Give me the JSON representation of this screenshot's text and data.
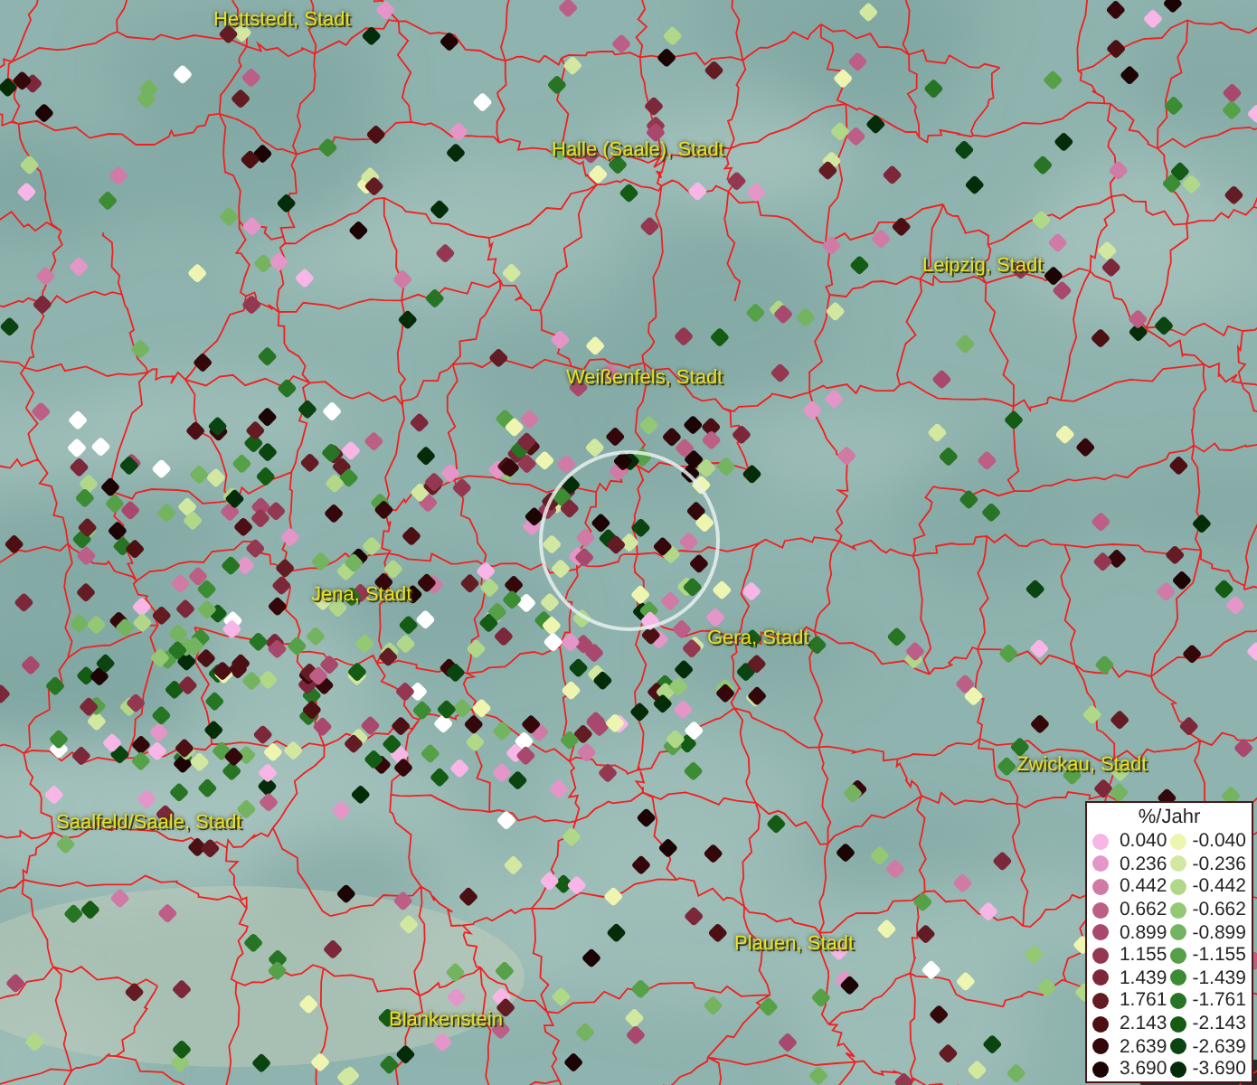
{
  "places": [
    {
      "label": "Hettstedt, Stadt"
    },
    {
      "label": "Halle (Saale), Stadt"
    },
    {
      "label": "Leipzig, Stadt"
    },
    {
      "label": "Weißenfels, Stadt"
    },
    {
      "label": "Jena, Stadt"
    },
    {
      "label": "Gera, Stadt"
    },
    {
      "label": "Zwickau, Stadt"
    },
    {
      "label": "Saalfeld/Saale, Stadt"
    },
    {
      "label": "Plauen, Stadt"
    },
    {
      "label": "Blankenstein"
    }
  ],
  "legend": {
    "title": "%/Jahr",
    "positive": [
      {
        "value": "0.040",
        "color": "#f7b6e6"
      },
      {
        "value": "0.236",
        "color": "#e496c8"
      },
      {
        "value": "0.442",
        "color": "#d07aa6"
      },
      {
        "value": "0.662",
        "color": "#bc5e86"
      },
      {
        "value": "0.899",
        "color": "#a8486c"
      },
      {
        "value": "1.155",
        "color": "#943852"
      },
      {
        "value": "1.439",
        "color": "#7c283a"
      },
      {
        "value": "1.761",
        "color": "#641c24"
      },
      {
        "value": "2.143",
        "color": "#4c1014"
      },
      {
        "value": "2.639",
        "color": "#34080a"
      },
      {
        "value": "3.690",
        "color": "#1c0404"
      }
    ],
    "negative": [
      {
        "value": "-0.040",
        "color": "#eef5b0"
      },
      {
        "value": "-0.236",
        "color": "#d2e8a0"
      },
      {
        "value": "-0.442",
        "color": "#b0d888"
      },
      {
        "value": "-0.662",
        "color": "#94c874"
      },
      {
        "value": "-0.899",
        "color": "#74b460"
      },
      {
        "value": "-1.155",
        "color": "#56a048"
      },
      {
        "value": "-1.439",
        "color": "#3c8c34"
      },
      {
        "value": "-1.761",
        "color": "#267424"
      },
      {
        "value": "-2.143",
        "color": "#145c14"
      },
      {
        "value": "-2.639",
        "color": "#0a4410"
      },
      {
        "value": "-3.690",
        "color": "#042c08"
      }
    ]
  }
}
